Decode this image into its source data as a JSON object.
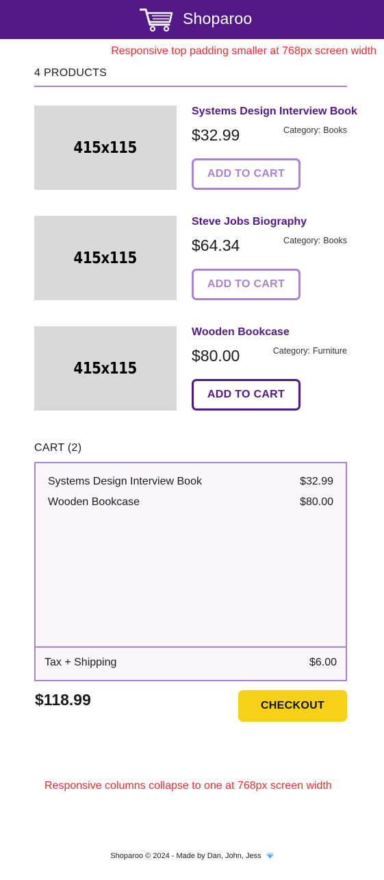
{
  "header": {
    "brand": "Shoparoo",
    "logo_icon": "shopping-cart-icon",
    "background_color": "#521885"
  },
  "notes": {
    "top": "Responsive top padding smaller at 768px screen width",
    "bottom": "Responsive columns collapse to one at 768px screen width"
  },
  "products_heading": "4 PRODUCTS",
  "products": [
    {
      "image_label": "415x115",
      "name": "Systems Design Interview Book",
      "price": "$32.99",
      "category_label": "Category:",
      "category": "Books",
      "button_label": "ADD TO CART",
      "button_state": "faded"
    },
    {
      "image_label": "415x115",
      "name": "Steve Jobs Biography",
      "price": "$64.34",
      "category_label": "Category:",
      "category": "Books",
      "button_label": "ADD TO CART",
      "button_state": "faded"
    },
    {
      "image_label": "415x115",
      "name": "Wooden Bookcase",
      "price": "$80.00",
      "category_label": "Category:",
      "category": "Furniture",
      "button_label": "ADD TO CART",
      "button_state": "active"
    }
  ],
  "cart": {
    "heading": "CART (2)",
    "items": [
      {
        "name": "Systems Design Interview Book",
        "price": "$32.99"
      },
      {
        "name": "Wooden Bookcase",
        "price": "$80.00"
      }
    ],
    "tax_label": "Tax + Shipping",
    "tax_value": "$6.00",
    "total": "$118.99",
    "checkout_label": "CHECKOUT"
  },
  "footer": {
    "text": "Shoparoo © 2024  -  Made by Dan, John, Jess",
    "icon": "gem-icon"
  },
  "colors": {
    "accent": "#521885",
    "accent_light": "#a983cf",
    "checkout": "#f7d117",
    "note": "#e03131"
  }
}
